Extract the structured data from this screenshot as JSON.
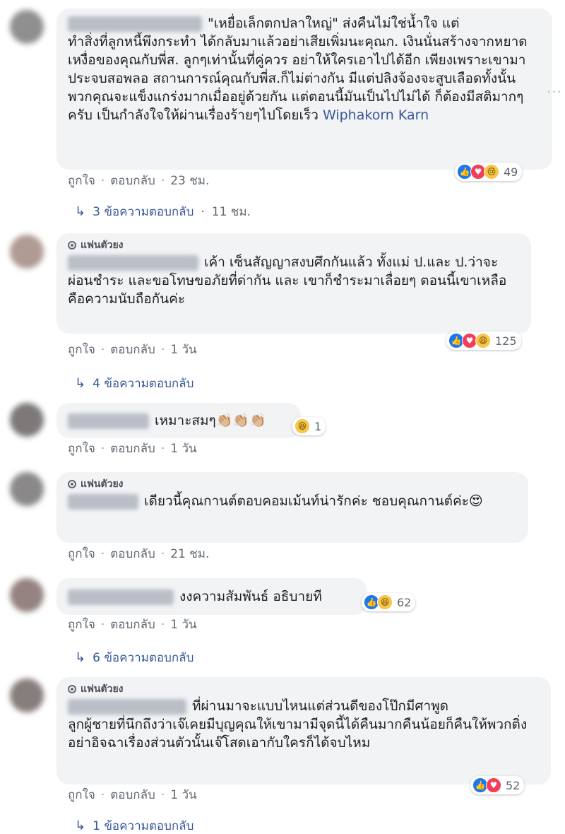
{
  "comments": [
    {
      "fan_badge": "",
      "text_line1": "\"เหยื่อเล็กตกปลาใหญ่\" ส่งคืนไม่ใช่น้ำใจ แต่",
      "text_rest": "ทำสิ่งที่ลูกหนี้พึงกระทำ ได้กลับมาแล้วอย่าเสียเพิ่มนะคุณก. เงินนั่นสร้างจากหยาดเหงื่อของคุณกับพี่ส. ลูกๆเท่านั้นที่คู่ควร อย่าให้ใครเอาไปได้อีก เพียงเพราะเขามาประจบสอพลอ สถานการณ์คุณกับพี่ส.ก็ไม่ต่างกัน มีแต่ปลิงจ้องจะสูบเลือดทั้งนั้น พวกคุณจะแข็งแกร่งมากเมื่ออยู่ด้วยกัน แต่ตอนนี้มันเป็นไปไม่ได้ ก็ต้องมีสติมากๆครับ เป็นกำลังใจให้ผ่านเรื่องร้ายๆไปโดยเร็ว",
      "mention": "Wiphakorn Karn",
      "like": "ถูกใจ",
      "reply": "ตอบกลับ",
      "time": "23 ชม.",
      "reactions": "49",
      "replies": "3 ข้อความตอบกลับ",
      "replies_time": "11 ชม."
    },
    {
      "fan_badge": "แฟนตัวยง",
      "text": "เค้า เซ็นสัญญาสงบศึกกันแล้ว ทั้งแม่ ป.และ ป.ว่าจะผ่อนชำระ และขอโทษขอภัยที่ด่ากัน และ เขาก็ชำระมาเลื่อยๆ ตอนนี้เขาเหลือ คือความนับถือกันค่ะ",
      "like": "ถูกใจ",
      "reply": "ตอบกลับ",
      "time": "1 วัน",
      "reactions": "125",
      "replies": "4 ข้อความตอบกลับ"
    },
    {
      "fan_badge": "",
      "text": "เหมาะสมๆ👏🏼👏🏼👏🏼",
      "like": "ถูกใจ",
      "reply": "ตอบกลับ",
      "time": "1 วัน",
      "reactions": "1"
    },
    {
      "fan_badge": "แฟนตัวยง",
      "text": "เดียวนี้คุณกานต์ตอบคอมเม้นท์น่ารักค่ะ ชอบคุณกานต์ค่ะ😍",
      "like": "ถูกใจ",
      "reply": "ตอบกลับ",
      "time": "21 ชม."
    },
    {
      "fan_badge": "",
      "text": "งงความสัมพันธ์ อธิบายที",
      "like": "ถูกใจ",
      "reply": "ตอบกลับ",
      "time": "1 วัน",
      "reactions": "62",
      "replies": "6 ข้อความตอบกลับ"
    },
    {
      "fan_badge": "แฟนตัวยง",
      "text_line1": "ที่ผ่านมาจะแบบไหนแต่ส่วนดีของโป๊กมีศาพูด",
      "text_rest": "ลูกผู้ชายที่นึกถึงว่าเจ๊เคยมีบุญคุณให้เขามามีจุดนี้ได้คืนมากคืนน้อยก็คืนให้พวกติ่งอย่าอิจฉาเรื่องส่วนตัวนั้นเจ๊โสดเอากับใครก็ได้จบไหม",
      "like": "ถูกใจ",
      "reply": "ตอบกลับ",
      "time": "1 วัน",
      "reactions": "52",
      "replies": "1 ข้อความตอบกลับ"
    }
  ]
}
